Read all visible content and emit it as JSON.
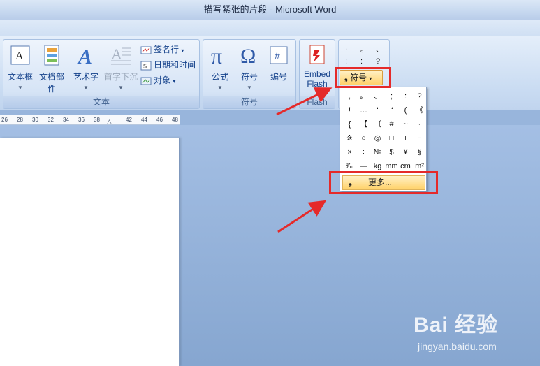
{
  "window": {
    "title": "描写紧张的片段 - Microsoft Word"
  },
  "ribbon": {
    "text_group": {
      "label": "文本",
      "buttons": [
        {
          "label": "文本框",
          "icon": "textbox-icon"
        },
        {
          "label": "文档部件",
          "icon": "quick-parts-icon"
        },
        {
          "label": "艺术字",
          "icon": "wordart-icon"
        },
        {
          "label": "首字下沉",
          "icon": "dropcap-icon",
          "disabled": true
        }
      ],
      "small": [
        {
          "label": "签名行",
          "icon": "signature-line-icon"
        },
        {
          "label": "日期和时间",
          "icon": "date-time-icon"
        },
        {
          "label": "对象",
          "icon": "object-icon"
        }
      ]
    },
    "symbols_group": {
      "label": "符号",
      "buttons": [
        {
          "label": "公式",
          "icon": "pi-icon"
        },
        {
          "label": "符号",
          "icon": "omega-icon"
        },
        {
          "label": "编号",
          "icon": "number-icon"
        }
      ]
    },
    "flash_group": {
      "label": "Flash",
      "button_line1": "Embed",
      "button_line2": "Flash",
      "icon": "flash-icon"
    },
    "mini_gallery": [
      ",",
      "。",
      "、",
      ";",
      ":",
      "?"
    ],
    "symbol_dropdown_button": "符号"
  },
  "symbol_dropdown": {
    "rows": [
      [
        ",",
        "。",
        "、",
        ";",
        ":",
        "?"
      ],
      [
        "!",
        "…",
        "‘",
        "“",
        "(",
        "《"
      ],
      [
        "{",
        "【",
        "〔",
        "#",
        "~",
        "·"
      ],
      [
        "※",
        "○",
        "◎",
        "□",
        "+",
        "−"
      ],
      [
        "×",
        "÷",
        "№",
        "$",
        "¥",
        "§"
      ],
      [
        "‰",
        "—",
        "kg",
        "mm",
        "cm",
        "m²"
      ]
    ],
    "more_label": "更多..."
  },
  "ruler": {
    "ticks": [
      "26",
      "28",
      "30",
      "32",
      "34",
      "36",
      "38",
      "42",
      "44",
      "46",
      "48"
    ]
  },
  "watermark": {
    "main": "Bai 经验",
    "sub": "jingyan.baidu.com"
  },
  "colors": {
    "highlight_red": "#e52a2a",
    "hover_orange": "#ffd26a",
    "ribbon_blue": "#cadcf2"
  }
}
